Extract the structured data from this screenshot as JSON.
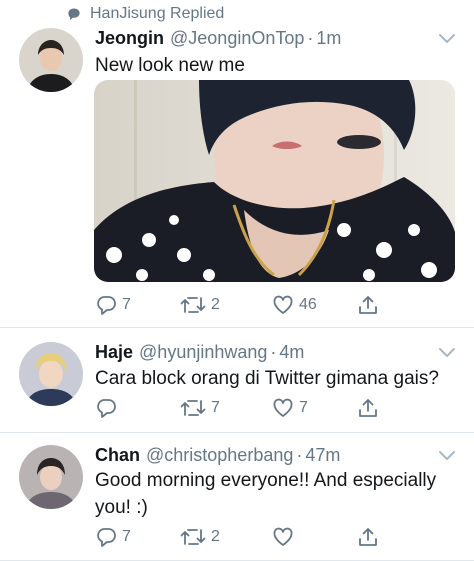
{
  "replied": {
    "text": "HanJisung Replied",
    "icon": "speech-bubble-icon"
  },
  "colors": {
    "secondary_text": "#657786",
    "separator": "#e1e8ed",
    "primary_text": "#14171a"
  },
  "tweets": [
    {
      "name": "Jeongin",
      "handle": "@JeonginOnTop",
      "separator": "·",
      "time": "1m",
      "text": "New look new me",
      "has_media": true,
      "actions": {
        "reply": "7",
        "retweet": "2",
        "like": "46"
      }
    },
    {
      "name": "Haje",
      "handle": "@hyunjinhwang",
      "separator": "·",
      "time": "4m",
      "text": "Cara block orang di Twitter gimana gais?",
      "has_media": false,
      "actions": {
        "reply": "",
        "retweet": "7",
        "like": "7"
      }
    },
    {
      "name": "Chan",
      "handle": "@christopherbang",
      "separator": "·",
      "time": "47m",
      "text": "Good morning everyone!! And especially you! :)",
      "has_media": false,
      "actions": {
        "reply": "7",
        "retweet": "2",
        "like": ""
      }
    }
  ]
}
